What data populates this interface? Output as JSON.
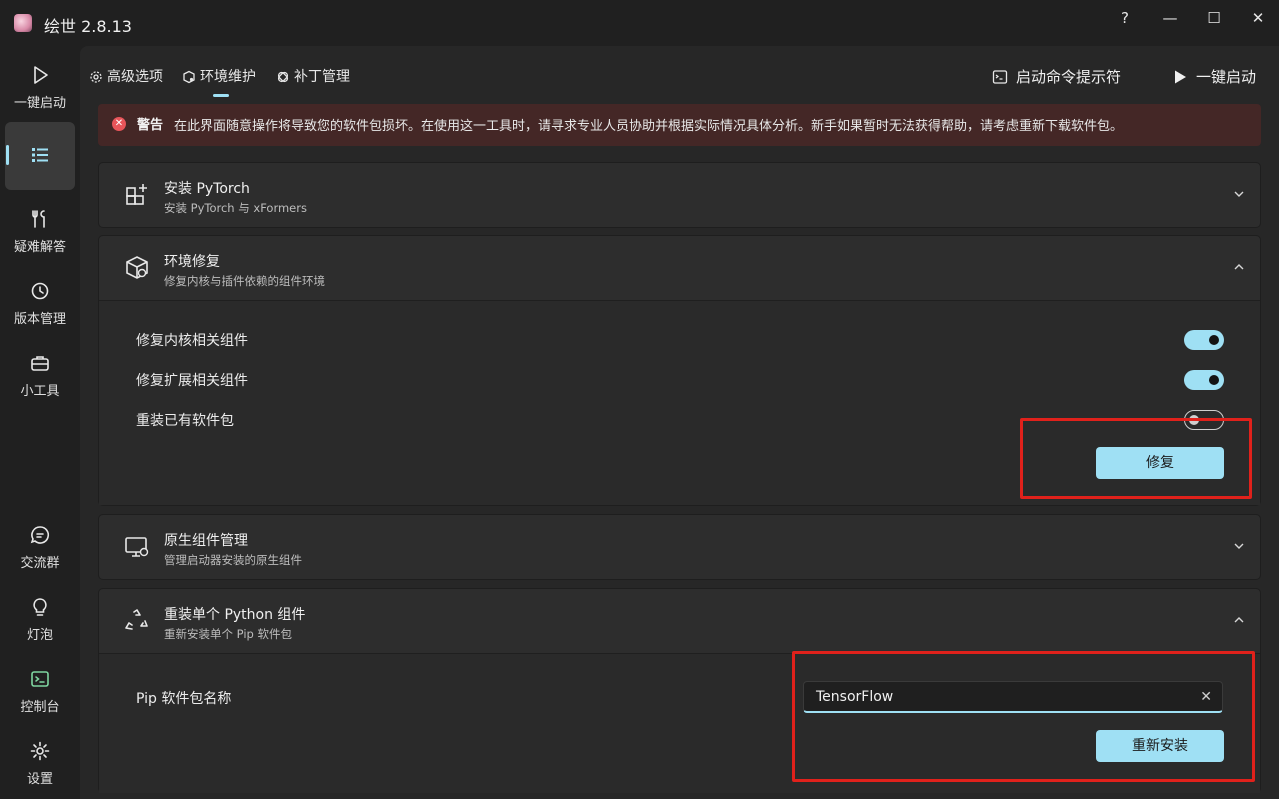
{
  "window": {
    "title": "绘世 2.8.13",
    "controls": {
      "help": "?",
      "minimize": "—",
      "maximize": "☐",
      "close": "✕"
    }
  },
  "sidebar": {
    "items": [
      {
        "label": "一键启动",
        "icon": "play-icon"
      },
      {
        "label": "",
        "icon": "list-icon",
        "active": true
      },
      {
        "label": "疑难解答",
        "icon": "wrench-icon"
      },
      {
        "label": "版本管理",
        "icon": "history-icon"
      },
      {
        "label": "小工具",
        "icon": "toolbox-icon"
      },
      {
        "label": "交流群",
        "icon": "chat-icon"
      },
      {
        "label": "灯泡",
        "icon": "lightbulb-icon"
      },
      {
        "label": "控制台",
        "icon": "console-icon"
      },
      {
        "label": "设置",
        "icon": "settings-gear-icon"
      }
    ]
  },
  "tabs": [
    {
      "label": "高级选项",
      "icon": "gear-icon"
    },
    {
      "label": "环境维护",
      "icon": "box-gear-icon",
      "active": true
    },
    {
      "label": "补丁管理",
      "icon": "patch-icon"
    }
  ],
  "top_actions": {
    "console": "启动命令提示符",
    "launch": "一键启动"
  },
  "warning": {
    "title": "警告",
    "text": "在此界面随意操作将导致您的软件包损坏。在使用这一工具时，请寻求专业人员协助并根据实际情况具体分析。新手如果暂时无法获得帮助，请考虑重新下载软件包。"
  },
  "cards": {
    "pytorch": {
      "title": "安装 PyTorch",
      "subtitle": "安装 PyTorch 与 xFormers",
      "expanded": false
    },
    "env_repair": {
      "title": "环境修复",
      "subtitle": "修复内核与插件依赖的组件环境",
      "expanded": true,
      "options": [
        {
          "label": "修复内核相关组件",
          "enabled": true
        },
        {
          "label": "修复扩展相关组件",
          "enabled": true
        },
        {
          "label": "重装已有软件包",
          "enabled": false
        }
      ],
      "button": "修复"
    },
    "native": {
      "title": "原生组件管理",
      "subtitle": "管理启动器安装的原生组件",
      "expanded": false
    },
    "reinstall": {
      "title": "重装单个 Python 组件",
      "subtitle": "重新安装单个 Pip 软件包",
      "expanded": true,
      "field_label": "Pip 软件包名称",
      "field_value": "TensorFlow",
      "button": "重新安装"
    }
  },
  "colors": {
    "accent": "#9fe0f4",
    "warning_bg": "#442726",
    "highlight_box": "#e0211b"
  }
}
